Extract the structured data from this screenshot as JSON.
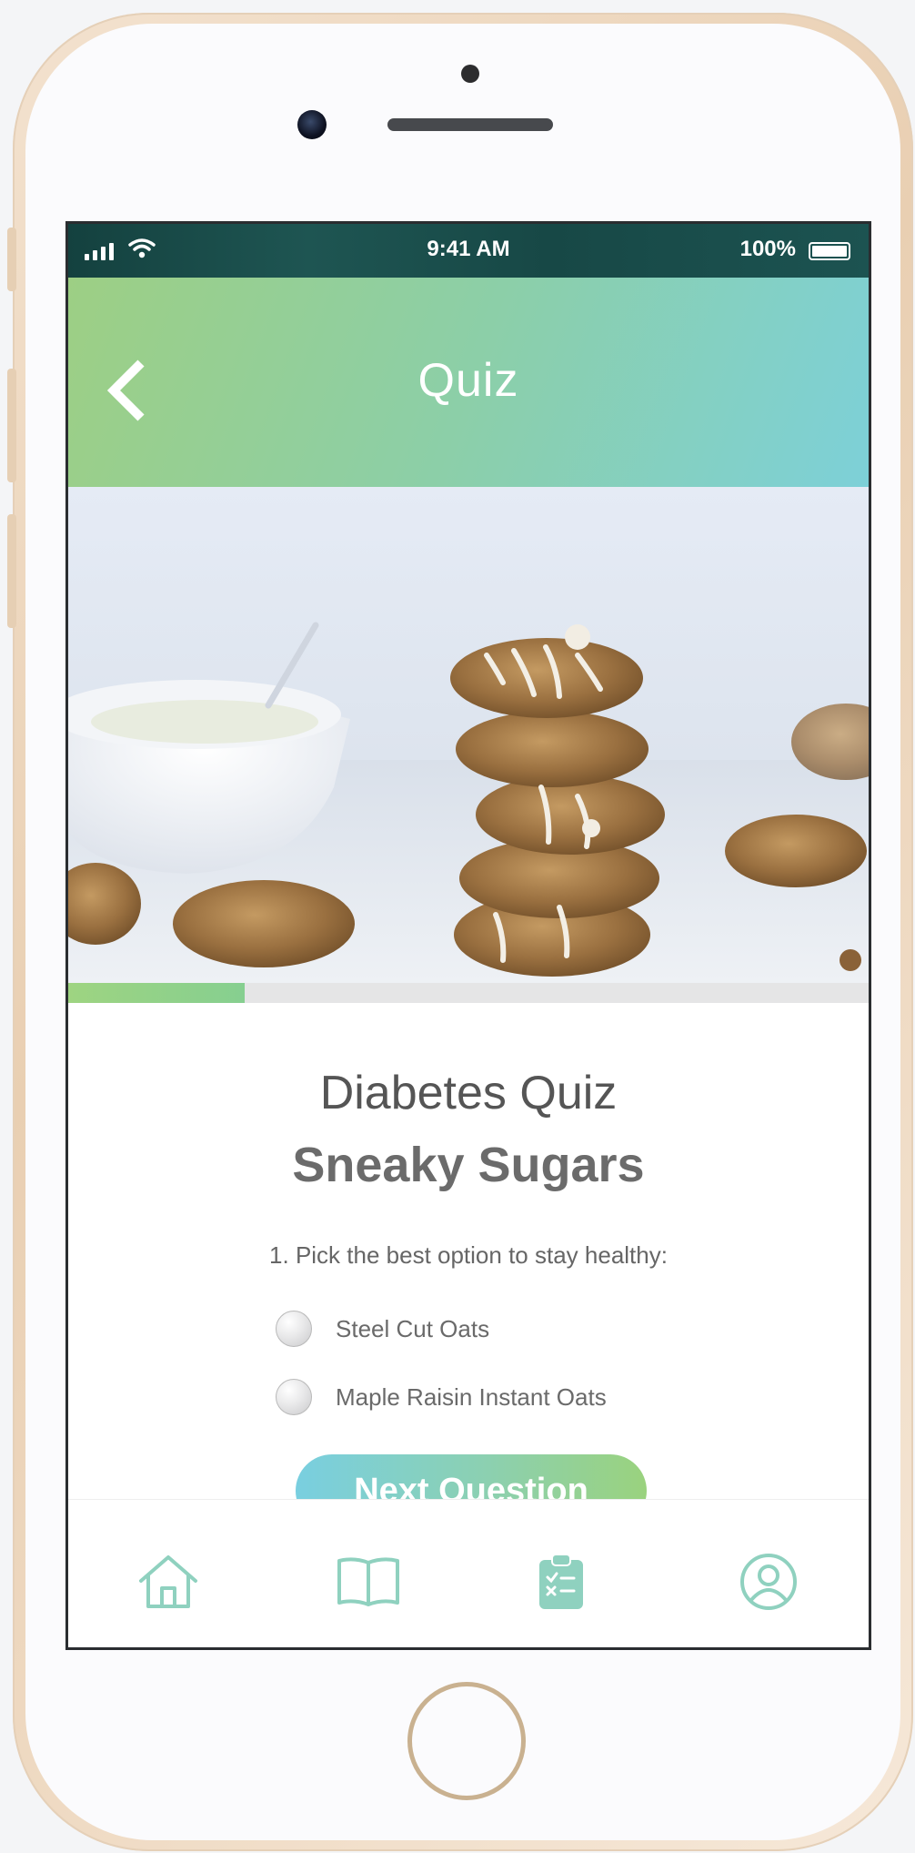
{
  "status_bar": {
    "time": "9:41 AM",
    "battery": "100%"
  },
  "header": {
    "title": "Quiz",
    "back_icon": "chevron-left-icon"
  },
  "hero": {
    "icon": "granola-cookies-photo"
  },
  "progress": {
    "value": 0.22
  },
  "quiz": {
    "title": "Diabetes Quiz",
    "subtitle": "Sneaky Sugars",
    "question": "1. Pick the best option to stay healthy:",
    "options": [
      {
        "label": "Steel Cut Oats",
        "selected": false
      },
      {
        "label": "Maple Raisin Instant Oats",
        "selected": false
      }
    ],
    "next_label": "Next Question"
  },
  "tabbar": {
    "items": [
      {
        "name": "home",
        "icon": "home-icon"
      },
      {
        "name": "learn",
        "icon": "book-icon"
      },
      {
        "name": "quiz",
        "icon": "clipboard-checklist-icon"
      },
      {
        "name": "profile",
        "icon": "user-icon"
      }
    ]
  },
  "colors": {
    "header_gradient_start": "#9dcf84",
    "header_gradient_end": "#7dd0d8",
    "progress_fill": "#9ed481",
    "button_gradient_start": "#79cfe0",
    "button_gradient_end": "#9ad27e",
    "tab_icon": "#8fd1bf"
  }
}
